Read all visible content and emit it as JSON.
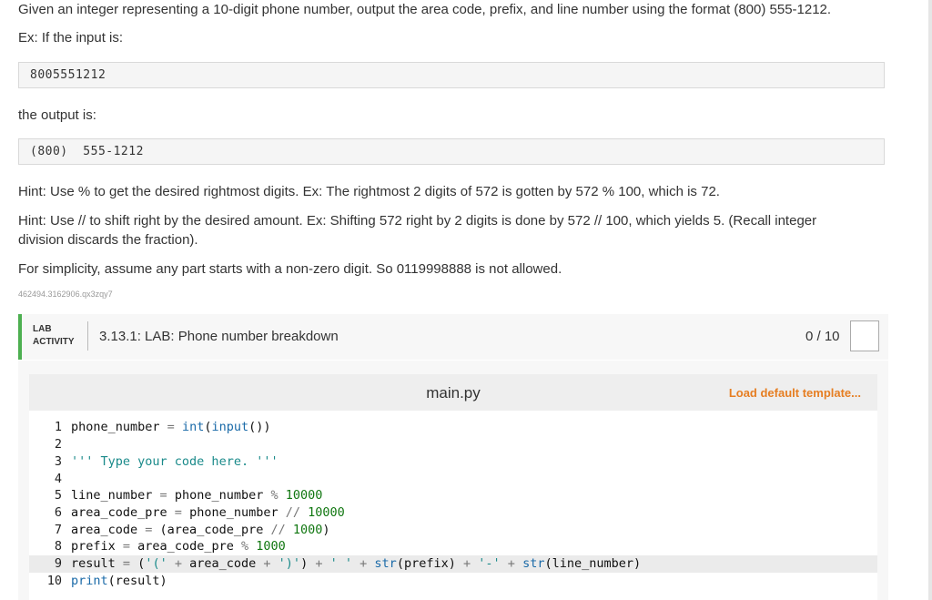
{
  "instructions": {
    "intro": "Given an integer representing a 10-digit phone number, output the area code, prefix, and line number using the format (800) 555-1212.",
    "input_label": "Ex: If the input is:",
    "example_input": "8005551212",
    "output_label": "the output is:",
    "example_output": "(800)  555-1212",
    "hint1": "Hint: Use % to get the desired rightmost digits. Ex: The rightmost 2 digits of 572 is gotten by 572 % 100, which is 72.",
    "hint2": "Hint: Use // to shift right by the desired amount. Ex: Shifting 572 right by 2 digits is done by 572 // 100, which yields 5. (Recall integer division discards the fraction).",
    "note": "For simplicity, assume any part starts with a non-zero digit. So 0119998888 is not allowed.",
    "id": "462494.3162906.qx3zqy7"
  },
  "lab": {
    "label_line1": "LAB",
    "label_line2": "ACTIVITY",
    "title": "3.13.1: LAB: Phone number breakdown",
    "score": "0 / 10",
    "accent": "#4caf50"
  },
  "editor": {
    "filename": "main.py",
    "load_template": "Load default template...",
    "line_numbers": [
      "1",
      "2",
      "3",
      "4",
      "5",
      "6",
      "7",
      "8",
      "9",
      "10"
    ],
    "code_lines": [
      "phone_number = int(input())",
      "",
      "''' Type your code here. '''",
      "",
      "line_number = phone_number % 10000",
      "area_code_pre = phone_number // 10000",
      "area_code = (area_code_pre // 1000)",
      "prefix = area_code_pre % 1000",
      "result = ('(' + area_code + ')') + ' ' + str(prefix) + '-' + str(line_number)",
      "print(result)"
    ],
    "active_line": 9
  }
}
